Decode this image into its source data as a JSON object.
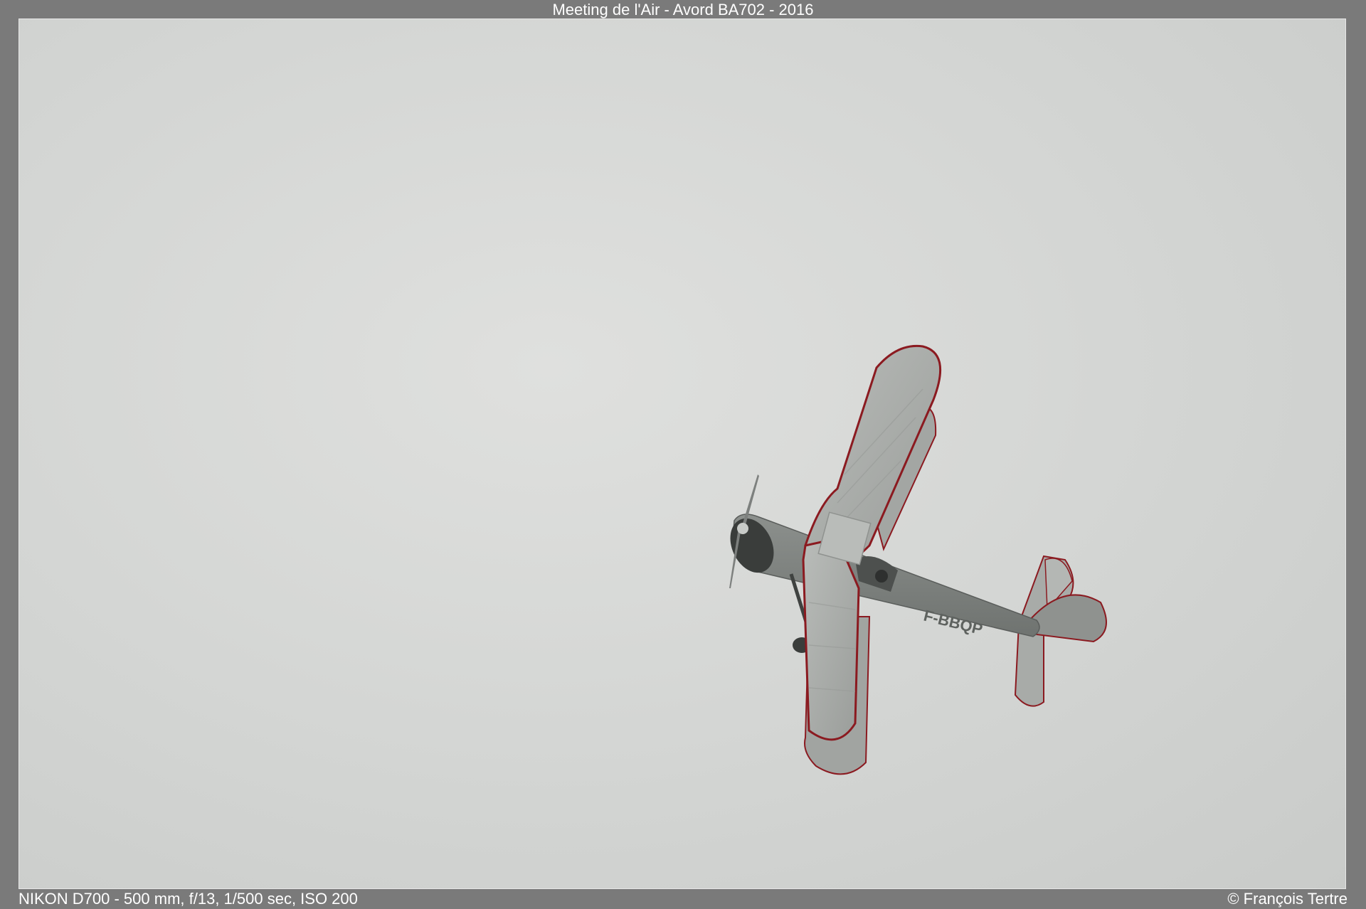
{
  "header": {
    "title": "Meeting de l'Air - Avord BA702 - 2016"
  },
  "photo": {
    "subject_icon": "biplane-in-flight",
    "sky_color": "#d6d8d6",
    "aircraft_color": "#a8aba8",
    "trim_color": "#a01c24",
    "registration": "F-BBQP"
  },
  "footer": {
    "exif": "NIKON D700 - 500 mm, f/13, 1/500 sec, ISO 200",
    "copyright": "© François Tertre"
  }
}
